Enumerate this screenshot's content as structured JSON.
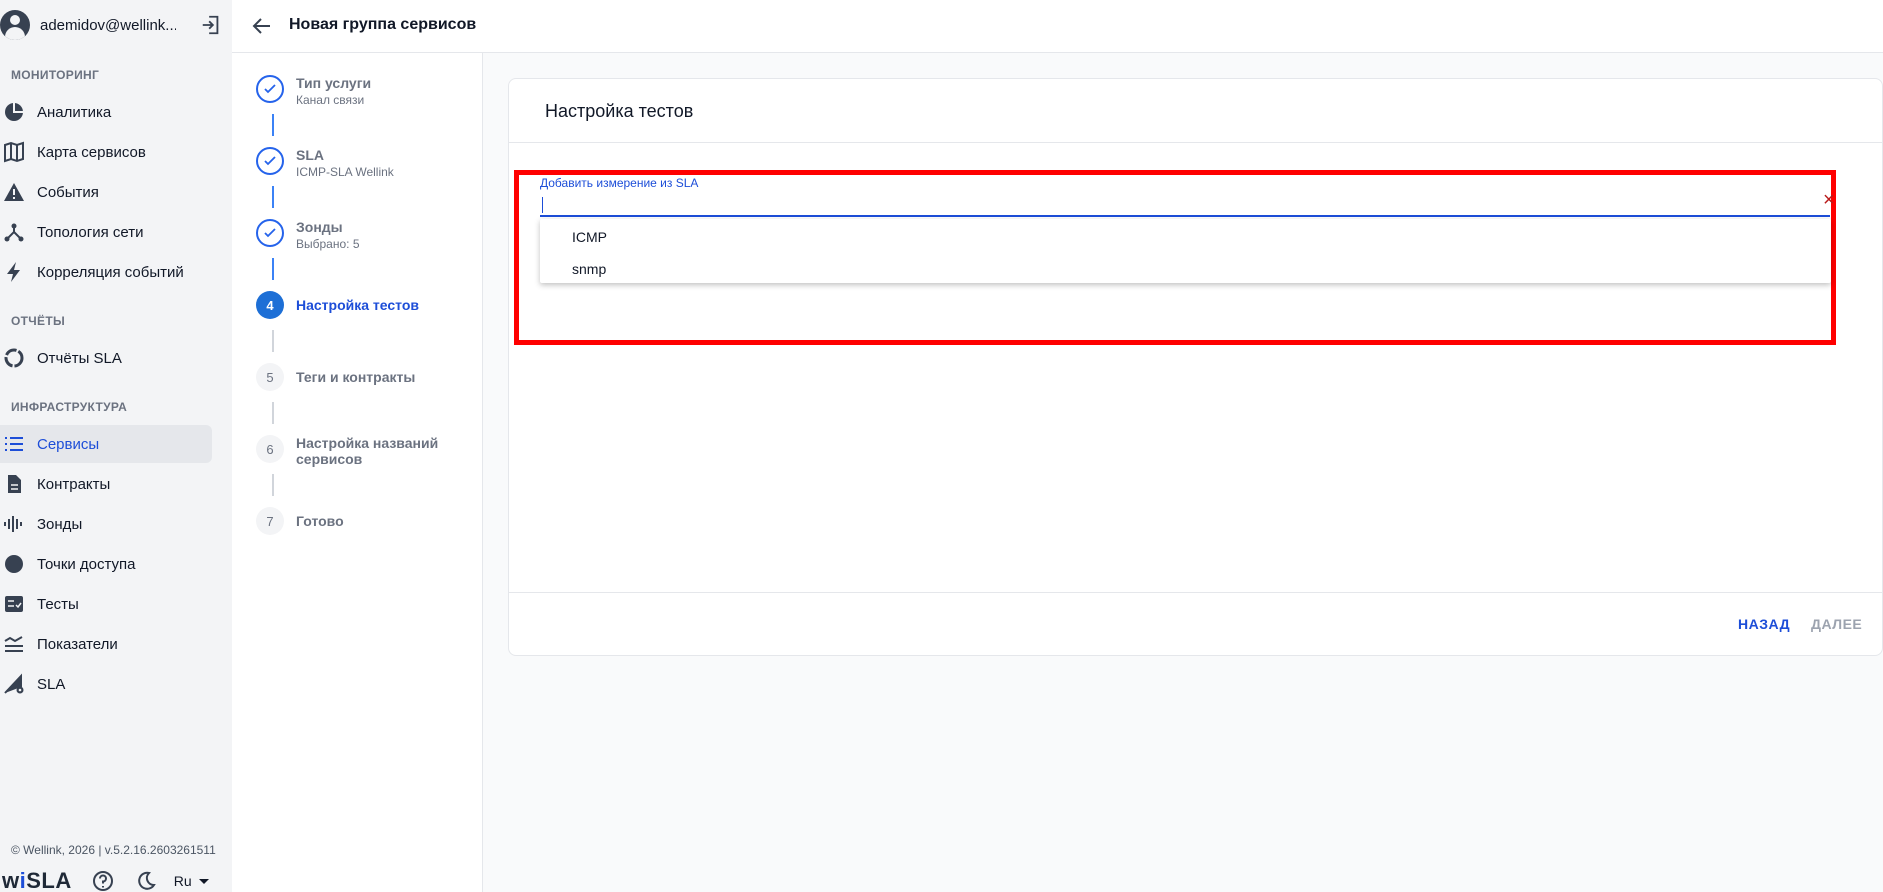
{
  "user": {
    "name": "ademidov@wellink..."
  },
  "sections": {
    "monitoring": "МОНИТОРИНГ",
    "reports": "ОТЧЁТЫ",
    "infrastructure": "ИНФРАСТРУКТУРА"
  },
  "nav": {
    "analytics": "Аналитика",
    "service_map": "Карта сервисов",
    "events": "События",
    "topology": "Топология сети",
    "correlation": "Корреляция событий",
    "sla_reports": "Отчёты SLA",
    "services": "Сервисы",
    "contracts": "Контракты",
    "probes": "Зонды",
    "access_points": "Точки доступа",
    "tests": "Тесты",
    "metrics": "Показатели",
    "sla": "SLA"
  },
  "footer": {
    "copyright": "© Wellink, 2026 | v.5.2.16.2603261511",
    "logo_prefix": "w",
    "logo_i": "i",
    "logo_suffix": "SLA",
    "language": "Ru"
  },
  "header": {
    "title": "Новая группа сервисов"
  },
  "steps": [
    {
      "number": "1",
      "title": "Тип услуги",
      "subtitle": "Канал связи",
      "state": "done"
    },
    {
      "number": "2",
      "title": "SLA",
      "subtitle": "ICMP-SLA Wellink",
      "state": "done"
    },
    {
      "number": "3",
      "title": "Зонды",
      "subtitle": "Выбрано: 5",
      "state": "done"
    },
    {
      "number": "4",
      "title": "Настройка тестов",
      "subtitle": "",
      "state": "current"
    },
    {
      "number": "5",
      "title": "Теги и контракты",
      "subtitle": "",
      "state": "pending"
    },
    {
      "number": "6",
      "title": "Настройка названий сервисов",
      "subtitle": "",
      "state": "pending"
    },
    {
      "number": "7",
      "title": "Готово",
      "subtitle": "",
      "state": "pending"
    }
  ],
  "card": {
    "title": "Настройка тестов",
    "field_label": "Добавить измерение из SLA",
    "field_value": "",
    "clear_glyph": "×",
    "options": [
      "ICMP",
      "snmp"
    ],
    "back_label": "НАЗАД",
    "next_label": "ДАЛЕЕ"
  },
  "colors": {
    "accent": "#1d4ed8",
    "highlight": "#ff0000"
  }
}
